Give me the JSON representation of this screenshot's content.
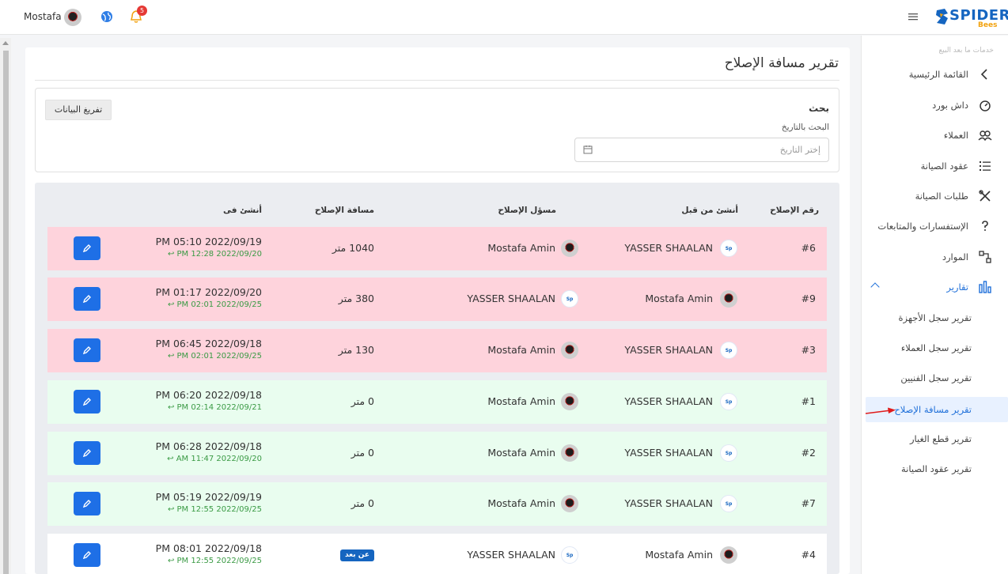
{
  "header": {
    "user_name": "Mostafa",
    "notification_count": "5",
    "logo_text": "SPIDER",
    "logo_sub": "Bees"
  },
  "sidebar": {
    "caption": "خدمات ما بعد البيع",
    "items": [
      {
        "label": "القائمة الرئيسية",
        "icon": "chevron-left-icon"
      },
      {
        "label": "داش بورد",
        "icon": "dashboard-icon"
      },
      {
        "label": "العملاء",
        "icon": "users-icon"
      },
      {
        "label": "عقود الصيانة",
        "icon": "list-icon"
      },
      {
        "label": "طلبات الصيانة",
        "icon": "tools-icon"
      },
      {
        "label": "الإستفسارات والمتابعات",
        "icon": "question-icon"
      },
      {
        "label": "الموارد",
        "icon": "resources-icon"
      },
      {
        "label": "تقارير",
        "icon": "chart-icon"
      }
    ],
    "sub_items": [
      {
        "label": "تقرير سجل الأجهزة"
      },
      {
        "label": "تقرير سجل العملاء"
      },
      {
        "label": "تقرير سجل الفنيين"
      },
      {
        "label": "تقرير مسافة الإصلاح",
        "active": true
      },
      {
        "label": "تقرير قطع الغيار"
      },
      {
        "label": "تقرير عقود الصيانة"
      }
    ]
  },
  "page": {
    "title": "تقرير مسافة الإصلاح",
    "search_title": "بحث",
    "date_label": "البحث بالتاريخ",
    "date_placeholder": "إختر التاريخ",
    "export_label": "تفريغ البيانات"
  },
  "table": {
    "headers": {
      "number": "رقم الإصلاح",
      "creator": "أنشئ من قبل",
      "responsible": "مسؤل الإصلاح",
      "distance": "مسافة الإصلاح",
      "created_at": "أنشئ فى"
    },
    "rows": [
      {
        "number": "#6",
        "creator": "YASSER SHAALAN",
        "creator_icon": "spider-logo-icon",
        "responsible": "Mostafa Amin",
        "responsible_icon": "person-avatar-icon",
        "distance": "1040 متر",
        "created": "PM 05:10 2022/09/19",
        "updated": "PM 12:28 2022/09/20 ↩",
        "status": "pink"
      },
      {
        "number": "#9",
        "creator": "Mostafa Amin",
        "creator_icon": "person-avatar-icon",
        "responsible": "YASSER SHAALAN",
        "responsible_icon": "spider-logo-icon",
        "distance": "380 متر",
        "created": "PM 01:17 2022/09/20",
        "updated": "PM 02:01 2022/09/25 ↩",
        "status": "pink"
      },
      {
        "number": "#3",
        "creator": "YASSER SHAALAN",
        "creator_icon": "spider-logo-icon",
        "responsible": "Mostafa Amin",
        "responsible_icon": "person-avatar-icon",
        "distance": "130 متر",
        "created": "PM 06:45 2022/09/18",
        "updated": "PM 02:01 2022/09/25 ↩",
        "status": "pink"
      },
      {
        "number": "#1",
        "creator": "YASSER SHAALAN",
        "creator_icon": "spider-logo-icon",
        "responsible": "Mostafa Amin",
        "responsible_icon": "person-avatar-icon",
        "distance": "0 متر",
        "created": "PM 06:20 2022/09/18",
        "updated": "PM 02:14 2022/09/21 ↩",
        "status": "green"
      },
      {
        "number": "#2",
        "creator": "YASSER SHAALAN",
        "creator_icon": "spider-logo-icon",
        "responsible": "Mostafa Amin",
        "responsible_icon": "person-avatar-icon",
        "distance": "0 متر",
        "created": "PM 06:28 2022/09/18",
        "updated": "AM 11:47 2022/09/20 ↩",
        "status": "green"
      },
      {
        "number": "#7",
        "creator": "YASSER SHAALAN",
        "creator_icon": "spider-logo-icon",
        "responsible": "Mostafa Amin",
        "responsible_icon": "person-avatar-icon",
        "distance": "0 متر",
        "created": "PM 05:19 2022/09/19",
        "updated": "PM 12:55 2022/09/25 ↩",
        "status": "green"
      },
      {
        "number": "#4",
        "creator": "Mostafa Amin",
        "creator_icon": "person-avatar-icon",
        "responsible": "YASSER SHAALAN",
        "responsible_icon": "spider-logo-icon",
        "distance": "",
        "distance_badge": "عن بعد",
        "created": "PM 08:01 2022/09/18",
        "updated": "PM 12:55 2022/09/25 ↩",
        "status": "white"
      }
    ]
  },
  "colors": {
    "primary": "#1e6fe6",
    "row_late": "#fed3dc",
    "row_ok": "#e9fdef",
    "updated_text": "#3a9a44"
  }
}
